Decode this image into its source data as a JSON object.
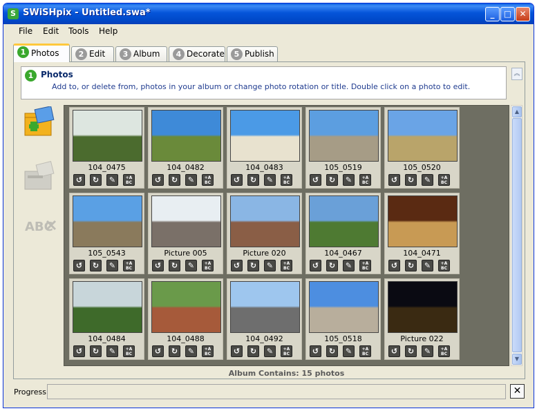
{
  "window": {
    "title": "SWiSHpix - Untitled.swa*",
    "app_icon_glyph": "S"
  },
  "titlebar_buttons": {
    "minimize": "_",
    "maximize": "□",
    "close": "✕"
  },
  "menu": [
    "File",
    "Edit",
    "Tools",
    "Help"
  ],
  "tabs": [
    {
      "num": "1",
      "label": "Photos"
    },
    {
      "num": "2",
      "label": "Edit"
    },
    {
      "num": "3",
      "label": "Album"
    },
    {
      "num": "4",
      "label": "Decorate"
    },
    {
      "num": "5",
      "label": "Publish"
    }
  ],
  "header": {
    "num": "1",
    "title": "Photos",
    "description": "Add to, or delete from, photos in your album or change photo rotation or title. Double click on a photo to edit."
  },
  "side_icons": [
    "add-photos-icon",
    "add-from-scanner-icon",
    "edit-title-icon"
  ],
  "action_icons": [
    "rotate-left-icon",
    "rotate-right-icon",
    "edit-icon",
    "edit-text-icon"
  ],
  "action_glyphs": {
    "rotate_left": "↺",
    "rotate_right": "↻",
    "edit": "✎",
    "text": "+A\nBC"
  },
  "photos": [
    {
      "label": "104_0475",
      "sky": "#dde6e0",
      "ground": "#4b6b2e"
    },
    {
      "label": "104_0482",
      "sky": "#3e8ad8",
      "ground": "#6a8a3a"
    },
    {
      "label": "104_0483",
      "sky": "#4b9ae6",
      "ground": "#e8e2cf"
    },
    {
      "label": "105_0519",
      "sky": "#5c9ee0",
      "ground": "#a69c86"
    },
    {
      "label": "105_0520",
      "sky": "#6aa4e6",
      "ground": "#b9a46a"
    },
    {
      "label": "105_0543",
      "sky": "#5aa0e4",
      "ground": "#8a7a5c"
    },
    {
      "label": "Picture 005",
      "sky": "#e8eef2",
      "ground": "#7a7068"
    },
    {
      "label": "Picture 020",
      "sky": "#8ab6e4",
      "ground": "#8a5e46"
    },
    {
      "label": "104_0467",
      "sky": "#6aa0d8",
      "ground": "#4e7a32"
    },
    {
      "label": "104_0471",
      "sky": "#5a2a12",
      "ground": "#c89a54"
    },
    {
      "label": "104_0484",
      "sky": "#c8d6da",
      "ground": "#3e6a2a"
    },
    {
      "label": "104_0488",
      "sky": "#6a9a4a",
      "ground": "#a65a3a"
    },
    {
      "label": "104_0492",
      "sky": "#9ec6ee",
      "ground": "#6e6e6e"
    },
    {
      "label": "105_0518",
      "sky": "#4d8ee0",
      "ground": "#b8ae9c"
    },
    {
      "label": "Picture 022",
      "sky": "#0a0a12",
      "ground": "#3a2a12"
    }
  ],
  "album_count": "Album Contains: 15 photos",
  "progress": {
    "label": "Progress:",
    "value": 0,
    "stop_glyph": "✕"
  }
}
